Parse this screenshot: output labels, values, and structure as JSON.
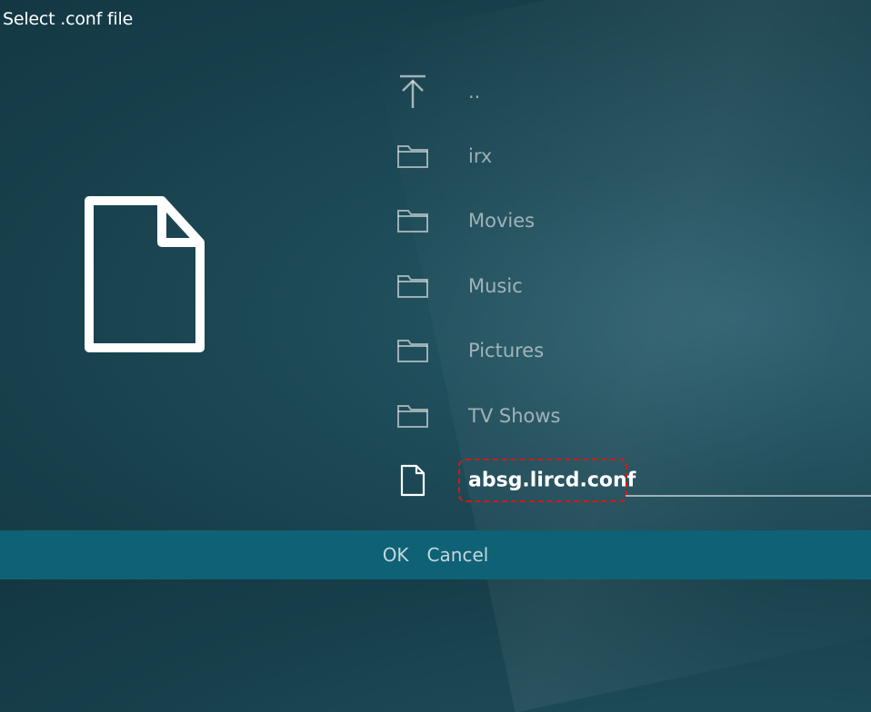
{
  "dialog": {
    "title": "Select .conf file"
  },
  "preview": {
    "icon": "file-icon"
  },
  "items": [
    {
      "label": "..",
      "icon": "up-arrow-icon",
      "type": "parent"
    },
    {
      "label": "irx",
      "icon": "folder-icon",
      "type": "folder"
    },
    {
      "label": "Movies",
      "icon": "folder-icon",
      "type": "folder"
    },
    {
      "label": "Music",
      "icon": "folder-icon",
      "type": "folder"
    },
    {
      "label": "Pictures",
      "icon": "folder-icon",
      "type": "folder"
    },
    {
      "label": "TV Shows",
      "icon": "folder-icon",
      "type": "folder"
    },
    {
      "label": "absg.lircd.conf",
      "icon": "file-icon",
      "type": "file",
      "selected": true
    }
  ],
  "footer": {
    "ok_label": "OK",
    "cancel_label": "Cancel"
  },
  "colors": {
    "background": "#1f4d5a",
    "footer": "#0f6176",
    "highlight_box": "#d11a1a"
  }
}
